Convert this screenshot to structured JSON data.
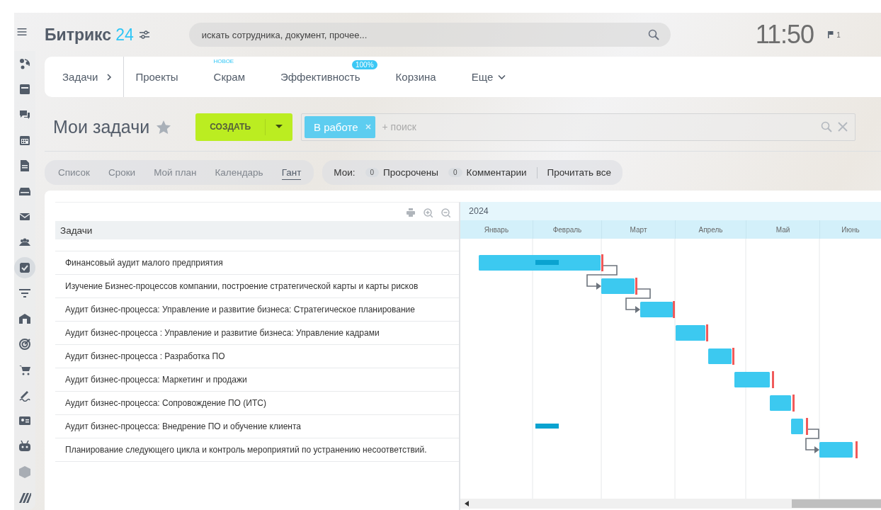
{
  "header": {
    "logo": {
      "name": "Битрикс",
      "number": "24"
    },
    "search": {
      "placeholder": "искать сотрудника, документ, прочее..."
    },
    "clock": "11:50",
    "flag_count": "1"
  },
  "sidebar": {
    "items": [
      {
        "kind": "pie",
        "selected": false
      },
      {
        "kind": "window",
        "selected": false
      },
      {
        "kind": "chat",
        "selected": false
      },
      {
        "kind": "calendar",
        "selected": false
      },
      {
        "kind": "document",
        "selected": false
      },
      {
        "kind": "drive",
        "selected": false
      },
      {
        "kind": "mail",
        "selected": false
      },
      {
        "kind": "people",
        "selected": false
      },
      {
        "kind": "tasks",
        "selected": true
      },
      {
        "kind": "filter",
        "selected": false
      },
      {
        "kind": "building",
        "selected": false
      },
      {
        "kind": "target",
        "selected": false
      },
      {
        "kind": "cart",
        "selected": false
      },
      {
        "kind": "sign",
        "selected": false
      },
      {
        "kind": "card",
        "selected": false
      },
      {
        "kind": "robot",
        "selected": false
      },
      {
        "kind": "cube",
        "selected": false
      },
      {
        "kind": "stripes",
        "selected": false
      }
    ]
  },
  "nav": {
    "items": [
      {
        "label": "Задачи",
        "kind": "section"
      },
      {
        "label": "Проекты",
        "kind": "link"
      },
      {
        "label": "Скрам",
        "kind": "link",
        "note": "НОВОЕ"
      },
      {
        "label": "Эффективность",
        "kind": "link",
        "badge": "100%"
      },
      {
        "label": "Корзина",
        "kind": "link"
      },
      {
        "label": "Еще",
        "kind": "more"
      }
    ]
  },
  "title": "Мои задачи",
  "create_button": "СОЗДАТЬ",
  "filter": {
    "chip": "В работе",
    "placeholder": "+ поиск"
  },
  "view_tabs": [
    {
      "label": "Список",
      "selected": false
    },
    {
      "label": "Сроки",
      "selected": false
    },
    {
      "label": "Мой план",
      "selected": false
    },
    {
      "label": "Календарь",
      "selected": false
    },
    {
      "label": "Гант",
      "selected": true
    }
  ],
  "counters": {
    "label": "Мои:",
    "items": [
      {
        "count": "0",
        "label": "Просрочены"
      },
      {
        "count": "0",
        "label": "Комментарии"
      }
    ],
    "read_all": "Прочитать все"
  },
  "table": {
    "column": "Задачи",
    "rows": [
      "Финансовый аудит малого предприятия",
      "Изучение Бизнес-процессов компании, построение стратегической карты и карты рисков",
      "Аудит бизнес-процесса: Управление и развитие бизнеса: Стратегическое планирование",
      "Аудит бизнес-процесса : Управление и развитие бизнеса: Управление кадрами",
      "Аудит бизнес-процесса : Разработка ПО",
      "Аудит бизнес-процесса: Маркетинг и продажи",
      "Аудит бизнес-процесса: Сопровождение ПО (ИТС)",
      "Аудит бизнес-процесса: Внедрение ПО и обучение клиента",
      "Планирование следующего цикла и контроль мероприятий по устранению несоответствий."
    ]
  },
  "gantt": {
    "year": "2024",
    "months": [
      "Январь",
      "Февраль",
      "Март",
      "Апрель",
      "Май",
      "Июнь"
    ]
  }
}
